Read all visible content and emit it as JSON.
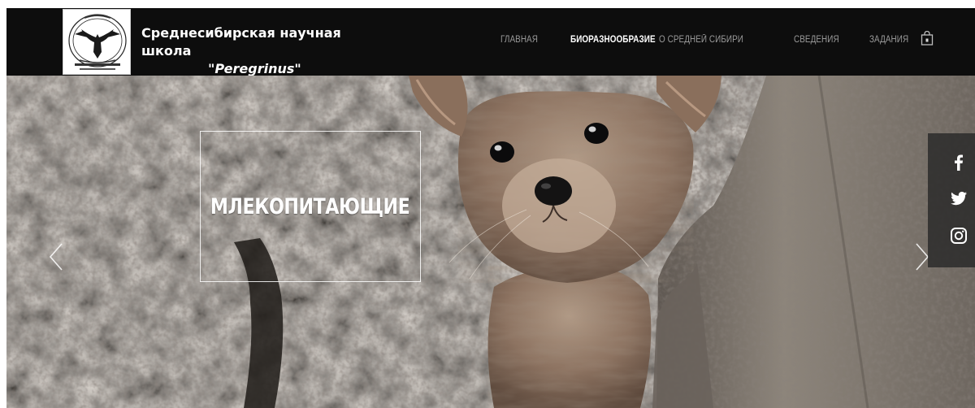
{
  "header": {
    "logo_icon": "eagle-emblem-icon",
    "title_line1": "Среднесибирская научная школа",
    "title_quote_open": "\"",
    "title_name": "Peregrinus",
    "title_quote_close": "\""
  },
  "nav": {
    "items": [
      {
        "label": "ГЛАВНАЯ",
        "active": false
      },
      {
        "label": "БИОРАЗНООБРАЗИЕ",
        "active": true
      },
      {
        "label": "О СРЕДНЕЙ СИБИРИ",
        "active": false
      },
      {
        "label": "СВЕДЕНИЯ",
        "active": false
      },
      {
        "label": "ЗАДАНИЯ",
        "active": false
      }
    ],
    "cart_icon": "shopping-bag-icon"
  },
  "hero": {
    "title": "МЛЕКОПИТАЮЩИЕ",
    "prev_icon": "chevron-left-icon",
    "next_icon": "chevron-right-icon"
  },
  "social": {
    "icons": [
      "facebook-icon",
      "twitter-icon",
      "instagram-icon"
    ]
  },
  "colors": {
    "header_bg": "#0d0d0d",
    "nav_text": "#9a9a9a",
    "nav_active": "#ffffff",
    "social_bg": "#282828"
  }
}
